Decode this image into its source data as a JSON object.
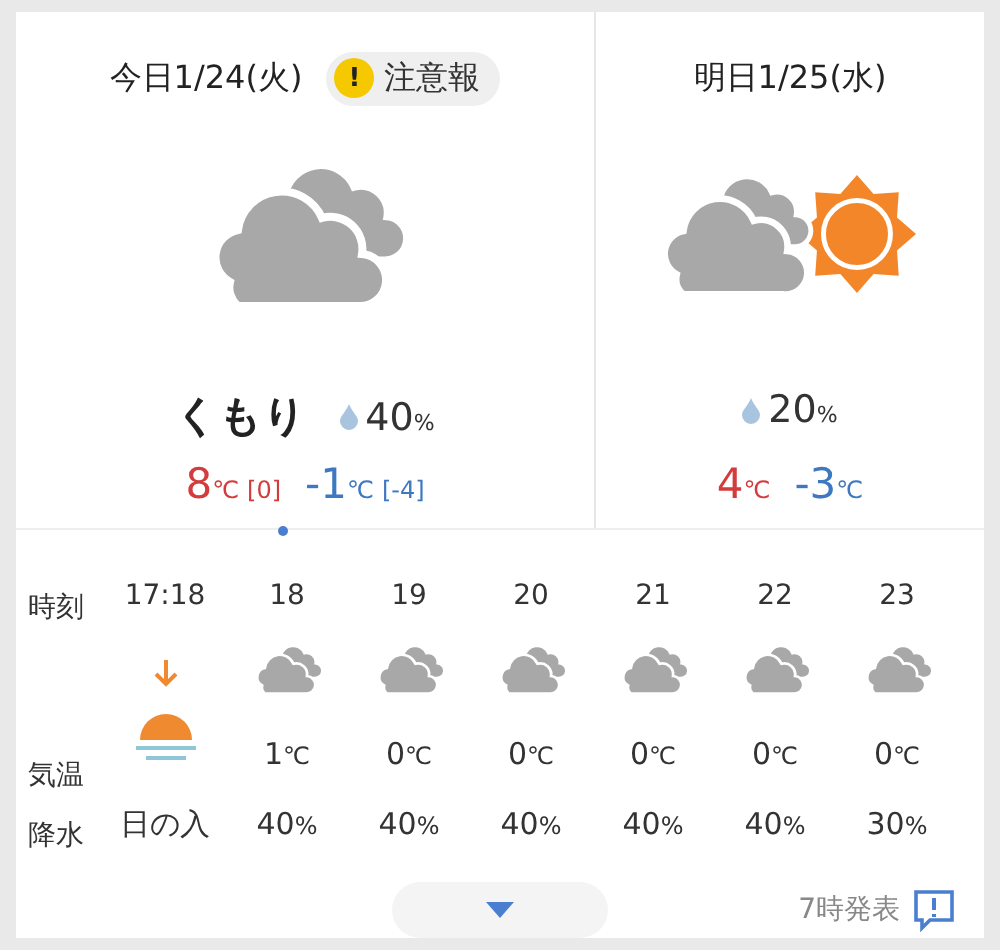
{
  "today": {
    "title": "今日1/24(火)",
    "warning": {
      "icon": "!",
      "label": "注意報"
    },
    "kind": "cloudy",
    "condition": "くもり",
    "precip": "40",
    "precip_unit": "%",
    "high": "8",
    "high_unit": "℃",
    "high_diff": "[0]",
    "low": "-1",
    "low_unit": "℃",
    "low_diff": "[-4]"
  },
  "tomorrow": {
    "title": "明日1/25(水)",
    "kind": "cloudy_sunny",
    "precip": "20",
    "precip_unit": "%",
    "high": "4",
    "high_unit": "℃",
    "low": "-3",
    "low_unit": "℃"
  },
  "hourly": {
    "row_labels": [
      "時刻",
      "気温",
      "降水"
    ],
    "columns": [
      {
        "time": "17:18",
        "kind": "sunset",
        "precip": "日の入"
      },
      {
        "time": "18",
        "kind": "cloudy",
        "temp": "1",
        "temp_unit": "℃",
        "precip": "40",
        "precip_unit": "%"
      },
      {
        "time": "19",
        "kind": "cloudy",
        "temp": "0",
        "temp_unit": "℃",
        "precip": "40",
        "precip_unit": "%"
      },
      {
        "time": "20",
        "kind": "cloudy",
        "temp": "0",
        "temp_unit": "℃",
        "precip": "40",
        "precip_unit": "%"
      },
      {
        "time": "21",
        "kind": "cloudy",
        "temp": "0",
        "temp_unit": "℃",
        "precip": "40",
        "precip_unit": "%"
      },
      {
        "time": "22",
        "kind": "cloudy",
        "temp": "0",
        "temp_unit": "℃",
        "precip": "40",
        "precip_unit": "%"
      },
      {
        "time": "23",
        "kind": "cloudy",
        "temp": "0",
        "temp_unit": "℃",
        "precip": "30",
        "precip_unit": "%"
      }
    ]
  },
  "footer": {
    "issued": "7時発表"
  }
}
